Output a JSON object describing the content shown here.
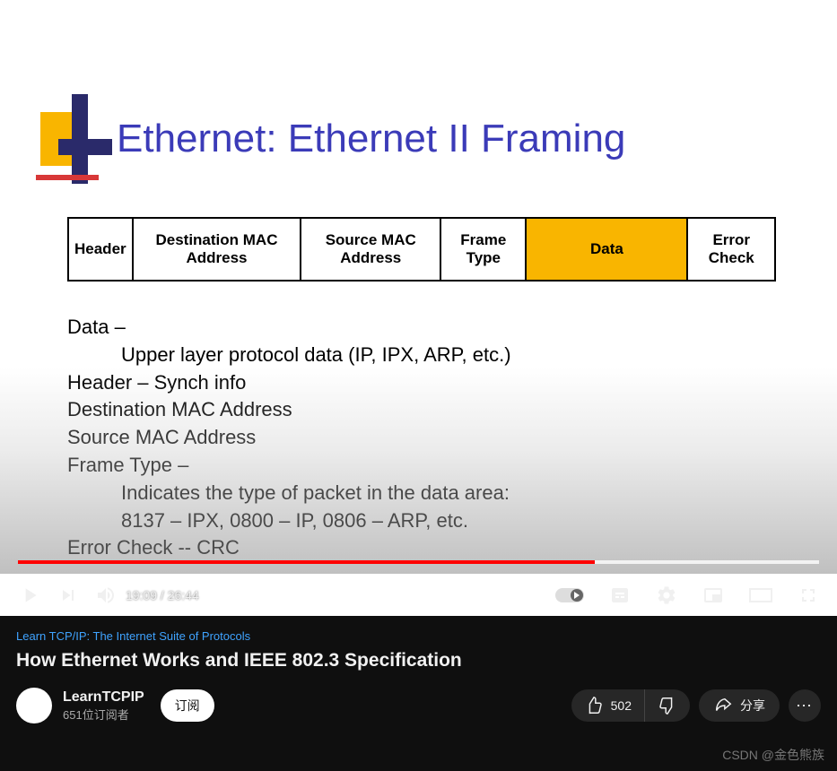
{
  "slide": {
    "title": "Ethernet:  Ethernet II Framing",
    "frame_cells": [
      "Header",
      "Destination MAC Address",
      "Source MAC Address",
      "Frame Type",
      "Data",
      "Error Check"
    ],
    "body_lines": [
      "Data –",
      "Upper layer protocol data  (IP, IPX, ARP, etc.)",
      "Header – Synch info",
      "Destination MAC Address",
      "Source MAC Address",
      "Frame Type –",
      "Indicates the type of packet in the data area:",
      "8137 – IPX, 0800 – IP, 0806 – ARP, etc.",
      "Error Check -- CRC"
    ]
  },
  "player": {
    "current_time": "19:09",
    "duration": "26:44",
    "time_display": "19:09 / 26:44"
  },
  "meta": {
    "playlist": "Learn TCP/IP: The Internet Suite of Protocols",
    "title": "How Ethernet Works and IEEE 802.3 Specification",
    "channel": "LearnTCPIP",
    "subscribers": "651位订阅者",
    "subscribe_label": "订阅",
    "likes": "502",
    "share_label": "分享"
  },
  "watermark": "CSDN @金色熊族"
}
